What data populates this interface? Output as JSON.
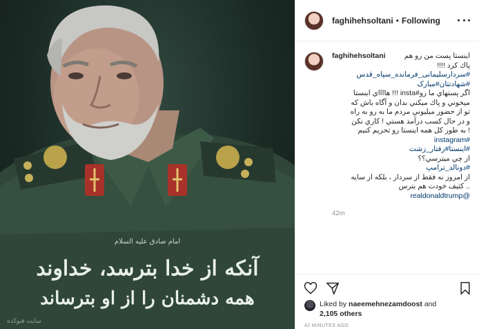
{
  "photo": {
    "caption_small": "امام صادق علیه السلام",
    "caption_line1": "آنکه از خدا بترسد، خداوند",
    "caption_line2": "همه دشمنان را از او بترساند",
    "watermark": "سایت فتوکده"
  },
  "header": {
    "username": "faghihehsoltani",
    "separator": "•",
    "follow_status": "Following",
    "more_icon": "more-horizontal-icon"
  },
  "caption": {
    "username": "faghihehsoltani",
    "first_line": "اینستا پست من رو هم",
    "lines": [
      "پاك كرد !!!!",
      "#سردارسلیمانی_فرمانده_سپاه_قدس",
      "#شهادتتان#مبارک",
      "اگر پستهاي ما رو#insta !!! هااااي اينستا",
      "ميخوني و پاك ميكني بدان و آگاه باش كه",
      "تو از حضور ميليوني مردم ما به رو به راه",
      "و در حال کسب درآمد هستي ! كاري نكن",
      "! به طور كل همه اينستا رو تحريم كنيم",
      "#instagram",
      "#اینستا#رفتار_زشت",
      "از چي ميترسي؟؟",
      "#دونالد_ترامپ",
      "از امروز نه فقط از سردار ، بلكه از سايه",
      ".. كثيف خودت هم بترس",
      "@realdonaldtrump"
    ],
    "tag_lines": [
      1,
      2,
      8,
      9,
      11,
      14
    ],
    "timestamp": "42m"
  },
  "actions": {
    "like_icon": "heart-icon",
    "share_icon": "send-icon",
    "save_icon": "bookmark-icon"
  },
  "likes": {
    "prefix": "Liked by ",
    "user": "naeemehnezamdoost",
    "middle": " and",
    "others": "2,105 others"
  },
  "date": "42 MINUTES AGO",
  "colors": {
    "text": "#262626",
    "link": "#00376b",
    "muted": "#8e8e8e",
    "border": "#efefef"
  }
}
